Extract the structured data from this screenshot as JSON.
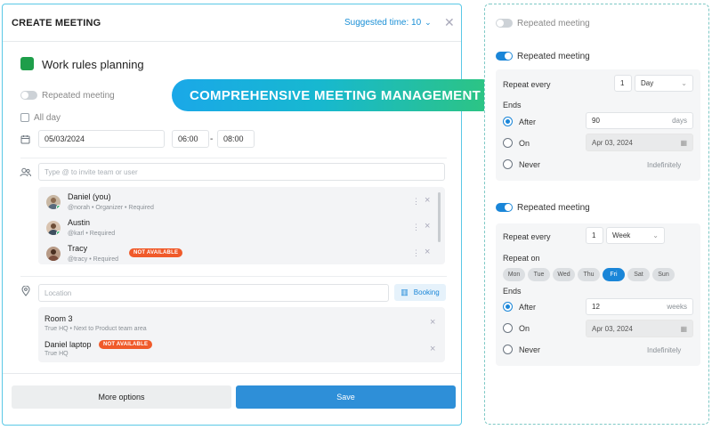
{
  "dialog": {
    "title": "CREATE MEETING",
    "suggested_time": "Suggested time: 10",
    "close_icon": "close-icon",
    "meeting_title": "Work rules planning",
    "meeting_color": "#1e9e4a",
    "repeated_label": "Repeated meeting",
    "all_day_label": "All day",
    "date": "05/03/2024",
    "start_time": "06:00",
    "time_separator": "-",
    "end_time": "08:00",
    "invite_placeholder": "Type @ to invite team or user",
    "attendees": [
      {
        "name": "Daniel (you)",
        "sub": "@norah • Organizer • Required"
      },
      {
        "name": "Austin",
        "sub": "@karl • Required"
      },
      {
        "name": "Tracy",
        "sub": "@tracy • Required",
        "badge": "NOT AVAILABLE"
      }
    ],
    "location_placeholder": "Location",
    "booking_label": "Booking",
    "resources": [
      {
        "name": "Room 3",
        "sub": "True HQ • Next to Product team area"
      },
      {
        "name": "Daniel laptop",
        "sub": "True HQ",
        "badge": "NOT AVAILABLE"
      }
    ],
    "more_options": "More options",
    "save": "Save"
  },
  "banner": "COMPREHENSIVE MEETING MANAGEMENT",
  "right_panel": {
    "off_label": "Repeated meeting",
    "daily": {
      "label": "Repeated meeting",
      "repeat_every": "Repeat every",
      "count": "1",
      "unit": "Day",
      "ends": "Ends",
      "after": "After",
      "after_value": "90",
      "after_unit": "days",
      "on": "On",
      "on_date": "Apr 03, 2024",
      "never": "Never",
      "indefinitely": "Indefinitely"
    },
    "weekly": {
      "label": "Repeated meeting",
      "repeat_every": "Repeat every",
      "count": "1",
      "unit": "Week",
      "repeat_on": "Repeat on",
      "days": [
        "Mon",
        "Tue",
        "Wed",
        "Thu",
        "Fri",
        "Sat",
        "Sun"
      ],
      "selected_day": "Fri",
      "ends": "Ends",
      "after": "After",
      "after_value": "12",
      "after_unit": "weeks",
      "on": "On",
      "on_date": "Apr 03, 2024",
      "never": "Never",
      "indefinitely": "Indefinitely"
    }
  },
  "colors": {
    "accent": "#1a86d8",
    "save_button": "#2e8fd8",
    "not_available": "#f05a2a",
    "banner_start": "#1aa8e8",
    "banner_end": "#2ec57e"
  }
}
